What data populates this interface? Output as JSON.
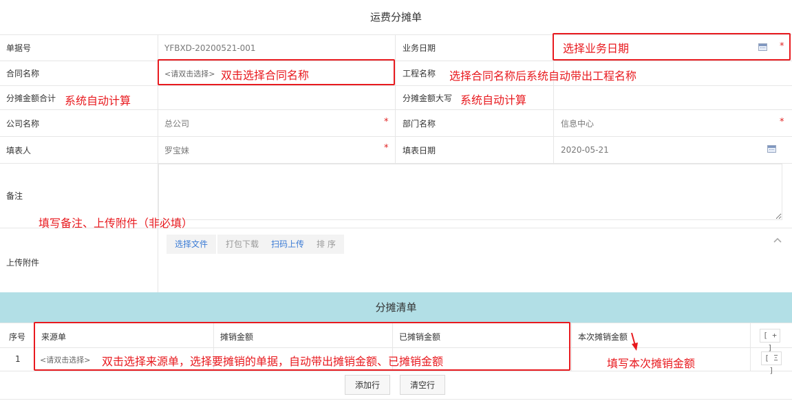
{
  "form": {
    "title": "运费分摊单",
    "doc_no_label": "单据号",
    "doc_no_value": "YFBXD-20200521-001",
    "biz_date_label": "业务日期",
    "contract_label": "合同名称",
    "contract_placeholder": "<请双击选择>",
    "project_label": "工程名称",
    "total_label": "分摊金额合计",
    "total_upper_label": "分摊金额大写",
    "company_label": "公司名称",
    "company_value": "总公司",
    "dept_label": "部门名称",
    "dept_value": "信息中心",
    "filler_label": "填表人",
    "filler_value": "罗宝妹",
    "fill_date_label": "填表日期",
    "fill_date_value": "2020-05-21",
    "remark_label": "备注",
    "attach_label": "上传附件",
    "required_mark": "*",
    "upload_buttons": [
      "选择文件",
      "打包下载",
      "扫码上传",
      "排 序"
    ],
    "collapse_icon": "chevron-up-icon",
    "calendar_icon": "calendar-icon"
  },
  "detail": {
    "title": "分摊清单",
    "columns": [
      "序号",
      "来源单",
      "摊销金额",
      "已摊销金额",
      "本次摊销金额"
    ],
    "add_row_button": "[ + ]",
    "row_menu_button": "[ Ξ ]",
    "rows": [
      {
        "seq": "1",
        "source": "<请双击选择>"
      }
    ],
    "add_row_label": "添加行",
    "clear_rows_label": "清空行"
  },
  "annotations": {
    "biz_date": "选择业务日期",
    "contract": "双击选择合同名称",
    "project": "选择合同名称后系统自动带出工程名称",
    "total": "系统自动计算",
    "total_upper": "系统自动计算",
    "remark": "填写备注、上传附件（非必填）",
    "source": "双击选择来源单，选择要摊销的单据，自动带出摊销金额、已摊销金额",
    "amount": "填写本次摊销金额"
  },
  "colors": {
    "annotation_red": "#e8191e",
    "band": "#b2dfe6",
    "link_blue": "#3a7bd5",
    "required_red": "#e02020"
  }
}
